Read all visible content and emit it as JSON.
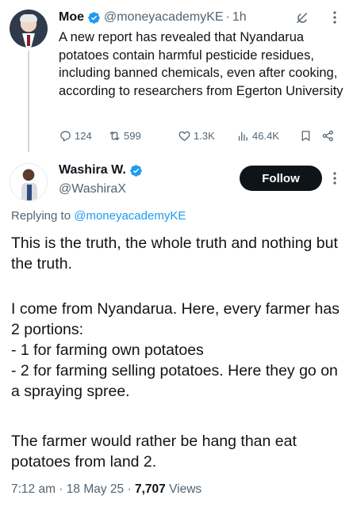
{
  "colors": {
    "text": "#0f1419",
    "secondary": "#536471",
    "link": "#1d9bf0",
    "verified": "#1d9bf0",
    "follow_bg": "#0f1419"
  },
  "parent_tweet": {
    "name": "Moe",
    "handle": "@moneyacademyKE",
    "separator": "·",
    "time": "1h",
    "text": "A new report has revealed that Nyandarua potatoes contain harmful pesticide residues, including banned chemicals, even after cooking, according to researchers from Egerton University",
    "actions": {
      "replies": "124",
      "reposts": "599",
      "likes": "1.3K",
      "views": "46.4K"
    }
  },
  "reply_tweet": {
    "name": "Washira W.",
    "handle": "@WashiraX",
    "follow_label": "Follow",
    "replying_prefix": "Replying to ",
    "replying_to": "@moneyacademyKE",
    "paragraphs": [
      "This is the truth, the whole truth and nothing but the truth.",
      "I come from Nyandarua. Here, every farmer has 2 portions:\n- 1 for farming own potatoes\n- 2 for farming selling potatoes. Here they go on a spraying spree.",
      "The farmer would rather be hang than eat potatoes from land 2."
    ],
    "meta": {
      "time": "7:12 am",
      "separator1": " · ",
      "date": "18 May 25",
      "separator2": " · ",
      "views_count": "7,707",
      "views_label": " Views"
    }
  },
  "icons": {
    "verified": "verified-badge-icon",
    "grok": "grok-icon",
    "more": "more-vertical-icon",
    "reply": "reply-icon",
    "repost": "repost-icon",
    "like": "heart-icon",
    "views": "views-bar-chart-icon",
    "bookmark": "bookmark-icon",
    "share": "share-icon"
  }
}
